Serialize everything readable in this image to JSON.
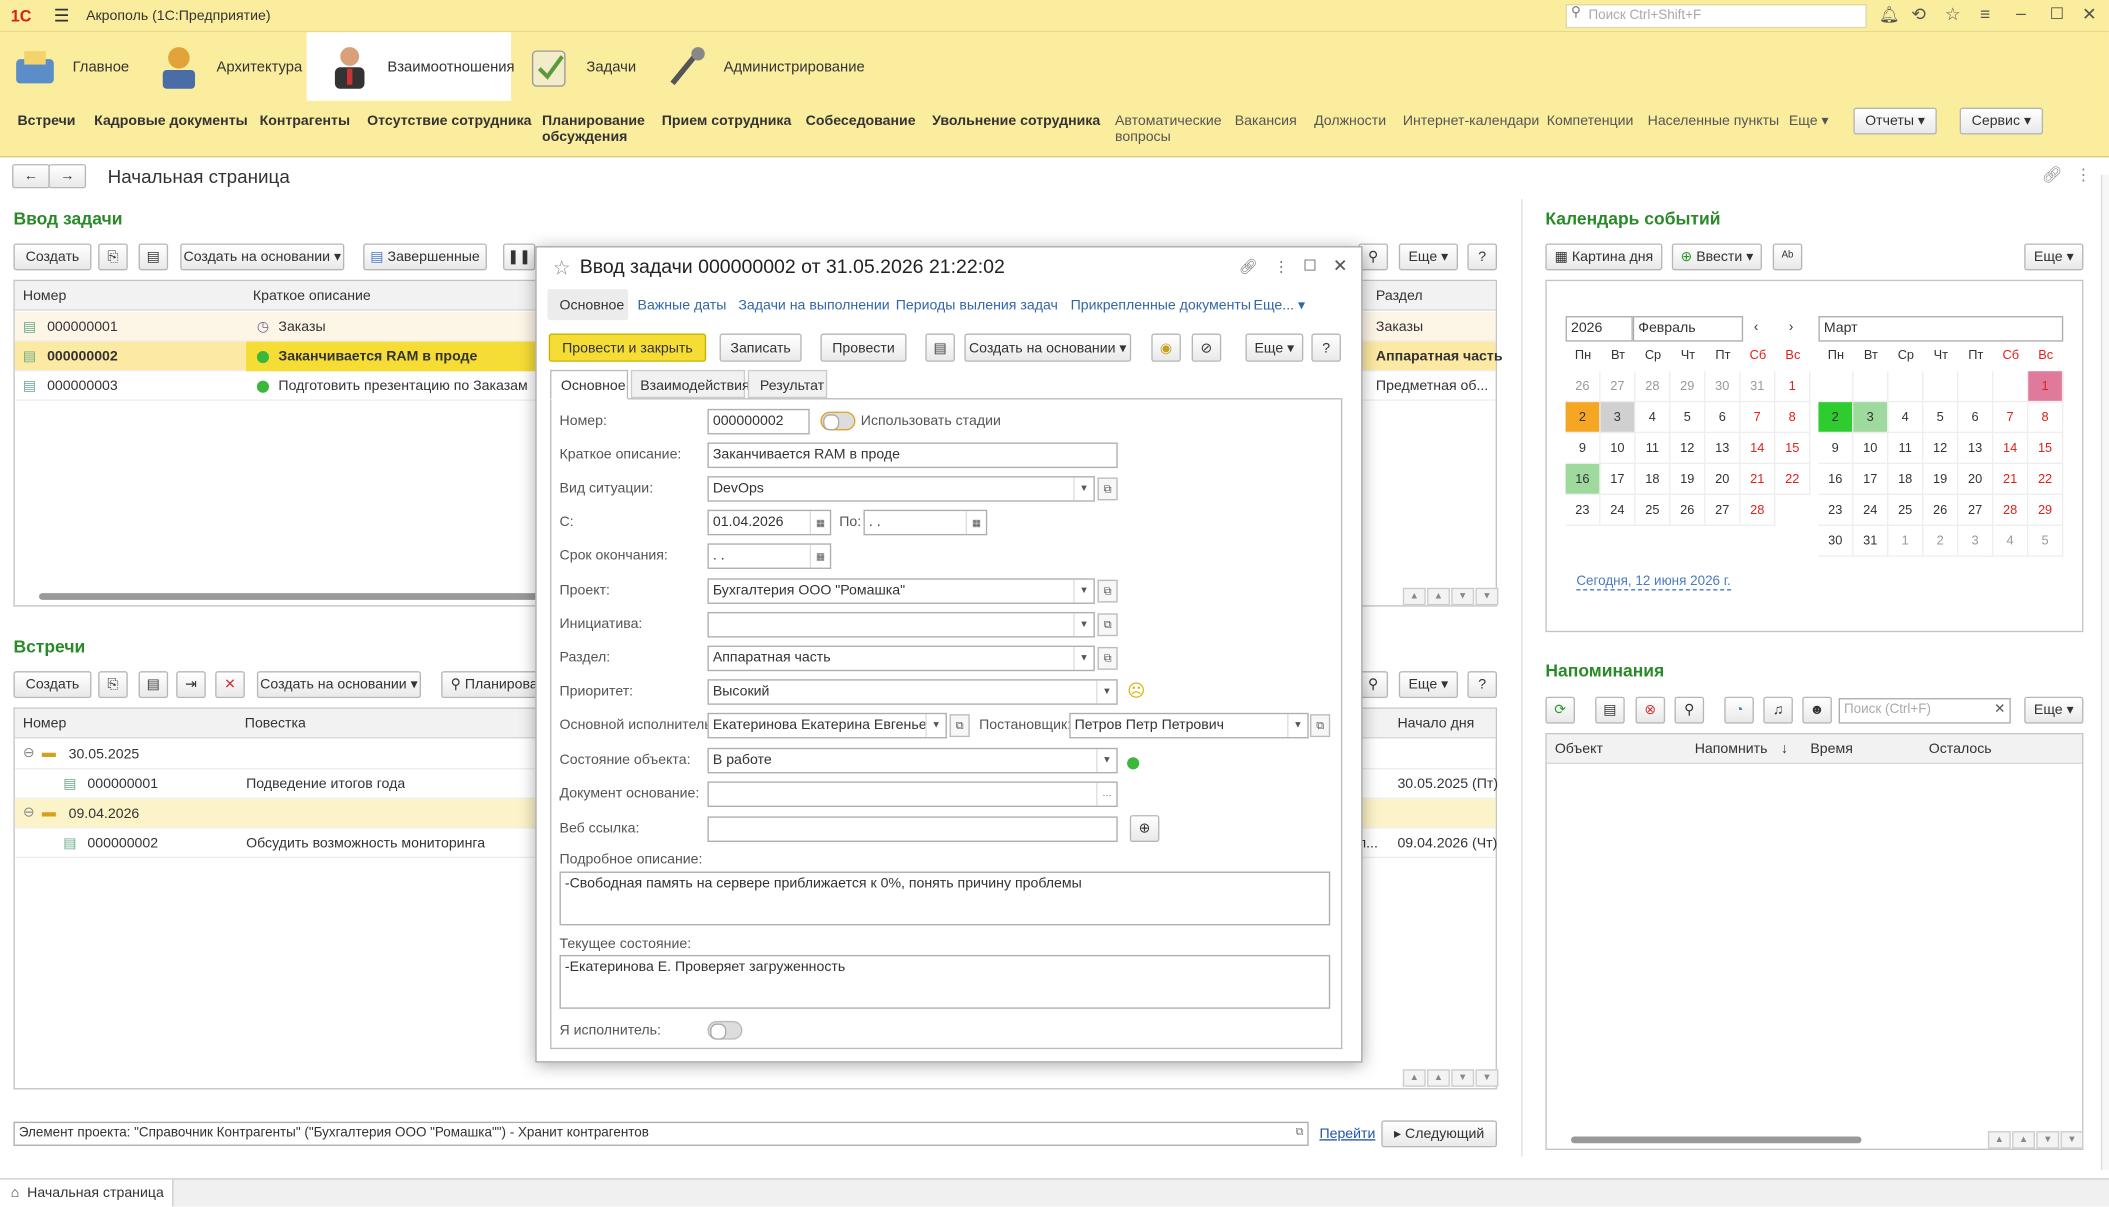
{
  "window": {
    "logo": "1С",
    "title": "Акрополь (1С:Предприятие)",
    "search_placeholder": "Поиск Ctrl+Shift+F"
  },
  "sections": [
    {
      "label": "Главное",
      "color": "#5b8ec9"
    },
    {
      "label": "Архитектура",
      "color": "#e2a33a"
    },
    {
      "label": "Взаимоотношения",
      "color": "#4a7bc2"
    },
    {
      "label": "Задачи",
      "color": "#7aa84a"
    },
    {
      "label": "Администрирование",
      "color": "#666666"
    }
  ],
  "commands": [
    "Встречи",
    "Кадровые документы",
    "Контрагенты",
    "Отсутствие сотрудника",
    "Планирование обсуждения",
    "Прием сотрудника",
    "Собеседование",
    "Увольнение сотрудника",
    "Автоматические вопросы",
    "Вакансия",
    "Должности",
    "Интернет-календари",
    "Компетенции",
    "Населенные пункты",
    "Еще",
    "Отчеты",
    "Сервис"
  ],
  "page": {
    "title": "Начальная страница"
  },
  "tasks": {
    "heading": "Ввод задачи",
    "buttons": [
      "Создать",
      "Создать на основании",
      "Завершенные",
      "Еще",
      "?"
    ],
    "columns": [
      "Номер",
      "Краткое описание",
      "Раздел"
    ],
    "rows": [
      {
        "num": "000000001",
        "desc": "Заказы",
        "section": "Заказы"
      },
      {
        "num": "000000002",
        "desc": "Заканчивается RAM в проде",
        "section": "Аппаратная часть"
      },
      {
        "num": "000000003",
        "desc": "Подготовить презентацию по Заказам",
        "section": "Предметная об..."
      }
    ]
  },
  "meetings": {
    "heading": "Встречи",
    "buttons": [
      "Создать",
      "Создать на основании",
      "Планирова",
      "Еще",
      "?"
    ],
    "columns": [
      "Номер",
      "Повестка",
      "Начало дня"
    ],
    "groups": [
      {
        "date": "30.05.2025",
        "num": "000000001",
        "agenda": "Подведение итогов года",
        "start": "30.05.2025 (Пт)"
      },
      {
        "date": "09.04.2026",
        "num": "000000002",
        "agenda": "Обсудить возможность мониторинга",
        "start": "09.04.2026 (Чт)",
        "trunc": "п..."
      }
    ]
  },
  "footer": {
    "project_element": "Элемент проекта: \"Справочник Контрагенты\" (\"Бухгалтерия ООО \"Ромашка\"\") - Хранит контрагентов",
    "go_link": "Перейти",
    "next_button": "Следующий",
    "tab": "Начальная страница"
  },
  "calendar": {
    "heading": "Календарь событий",
    "day_picture": "Картина дня",
    "enter": "Ввести",
    "more": "Еще",
    "year": "2026",
    "month1": "Февраль",
    "month2": "Март",
    "dows": [
      "Пн",
      "Вт",
      "Ср",
      "Чт",
      "Пт",
      "Сб",
      "Вс"
    ],
    "feb": [
      "26",
      "27",
      "28",
      "29",
      "30",
      "31",
      "1",
      "2",
      "3",
      "4",
      "5",
      "6",
      "7",
      "8",
      "9",
      "10",
      "11",
      "12",
      "13",
      "14",
      "15",
      "16",
      "17",
      "18",
      "19",
      "20",
      "21",
      "22",
      "23",
      "24",
      "25",
      "26",
      "27",
      "28"
    ],
    "mar": [
      "",
      "",
      "",
      "",
      "",
      "",
      "1",
      "2",
      "3",
      "4",
      "5",
      "6",
      "7",
      "8",
      "9",
      "10",
      "11",
      "12",
      "13",
      "14",
      "15",
      "16",
      "17",
      "18",
      "19",
      "20",
      "21",
      "22",
      "23",
      "24",
      "25",
      "26",
      "27",
      "28",
      "29",
      "30",
      "31",
      "1",
      "2",
      "3",
      "4",
      "5"
    ],
    "today": "Сегодня, 12 июня 2026 г.",
    "colors": {
      "orange": "#f5a623",
      "gray": "#d0d0d0",
      "green": "#2ecc2e",
      "lightgreen": "#9ed99e",
      "pink": "#e07a9a"
    }
  },
  "reminders": {
    "heading": "Напоминания",
    "search_placeholder": "Поиск (Ctrl+F)",
    "more": "Еще",
    "columns": [
      "Объект",
      "Напомнить",
      "Время",
      "Осталось"
    ]
  },
  "dialog": {
    "title": "Ввод задачи 000000002 от 31.05.2026 21:22:02",
    "tabs": [
      "Основное",
      "Важные даты",
      "Задачи на выполнении",
      "Периоды выления задач",
      "Прикрепленные документы",
      "Еще..."
    ],
    "buttons": [
      "Провести и закрыть",
      "Записать",
      "Провести",
      "Создать на основании",
      "Еще",
      "?"
    ],
    "subtabs": [
      "Основное",
      "Взаимодействия",
      "Результат"
    ],
    "fields": {
      "number_label": "Номер:",
      "number": "000000002",
      "use_stages": "Использовать стадии",
      "short_label": "Краткое описание:",
      "short": "Заканчивается RAM в проде",
      "situation_label": "Вид ситуации:",
      "situation": "DevOps",
      "from_label": "С:",
      "from": "01.04.2026",
      "to_label": "По:",
      "to": " .  .",
      "deadline_label": "Срок окончания:",
      "deadline": " .  .",
      "project_label": "Проект:",
      "project": "Бухгалтерия ООО \"Ромашка\"",
      "initiative_label": "Инициатива:",
      "initiative": "",
      "section_label": "Раздел:",
      "section": "Аппаратная часть",
      "priority_label": "Приоритет:",
      "priority": "Высокий",
      "executor_label": "Основной исполнитель:",
      "executor": "Екатеринова Екатерина Евгеньевна",
      "setter_label": "Постановщик:",
      "setter": "Петров Петр Петрович",
      "state_label": "Состояние объекта:",
      "state": "В работе",
      "basedoc_label": "Документ основание:",
      "basedoc": "",
      "web_label": "Веб ссылка:",
      "web": "",
      "detail_label": "Подробное описание:",
      "detail": "-Свободная память на сервере приближается к 0%, понять причину проблемы",
      "current_label": "Текущее состояние:",
      "current": "-Екатеринова Е. Проверяет загруженность",
      "iam_label": "Я исполнитель:"
    }
  }
}
